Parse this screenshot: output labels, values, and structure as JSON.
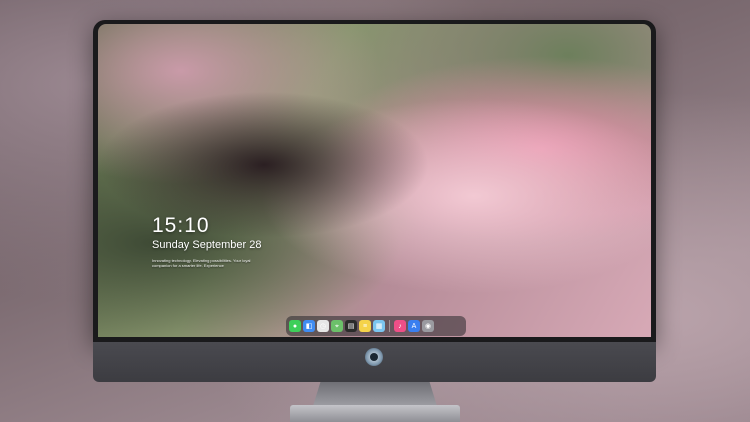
{
  "lockscreen": {
    "time": "15:10",
    "date": "Sunday September 28",
    "quote": "Innovating technology. Elevating possibilities. Your loyal companion for a smarter life. Experience"
  },
  "dock": {
    "items": [
      {
        "name": "messages-icon",
        "color": "#3ecf5a",
        "glyph": "●"
      },
      {
        "name": "finder-icon",
        "color": "#3f8cf2",
        "glyph": "◧"
      },
      {
        "name": "clock-icon",
        "color": "#e6e6e6",
        "glyph": "◷"
      },
      {
        "name": "maps-icon",
        "color": "#6cc06a",
        "glyph": "⌖"
      },
      {
        "name": "clapper-icon",
        "color": "#2b2b2b",
        "glyph": "▤"
      },
      {
        "name": "notes-icon",
        "color": "#f5d34a",
        "glyph": "≡"
      },
      {
        "name": "photos-icon",
        "color": "#7bc5f0",
        "glyph": "▦"
      },
      {
        "name": "music-icon",
        "color": "#ef4f87",
        "glyph": "♪"
      },
      {
        "name": "app-store-icon",
        "color": "#3a7ff0",
        "glyph": "A"
      },
      {
        "name": "camera-icon",
        "color": "#9a9aa0",
        "glyph": "◉"
      }
    ]
  }
}
